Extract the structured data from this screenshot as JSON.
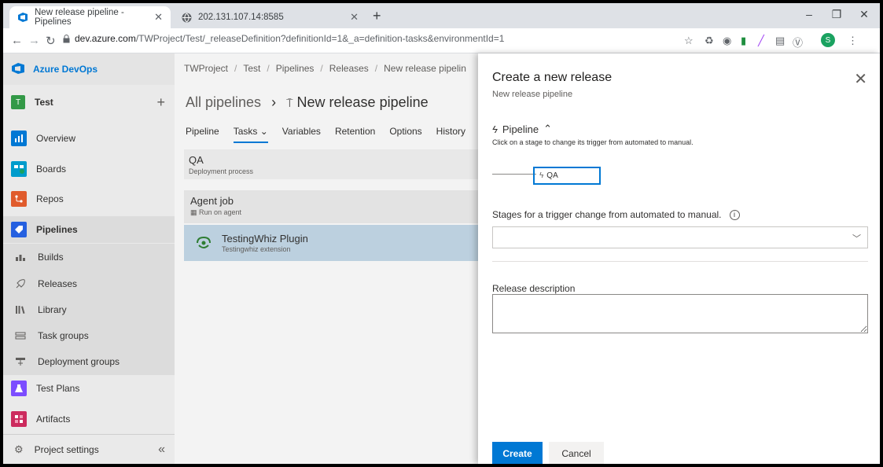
{
  "browser": {
    "tabs": [
      {
        "title": "New release pipeline - Pipelines",
        "active": true
      },
      {
        "title": "202.131.107.14:8585",
        "active": false
      }
    ],
    "url_host": "dev.azure.com",
    "url_path": "/TWProject/Test/_releaseDefinition?definitionId=1&_a=definition-tasks&environmentId=1",
    "profile_initial": "S"
  },
  "app": {
    "name": "Azure DevOps",
    "project_badge": "T",
    "project_name": "Test",
    "nav": [
      {
        "label": "Overview",
        "icon": "overview-icon"
      },
      {
        "label": "Boards",
        "icon": "boards-icon"
      },
      {
        "label": "Repos",
        "icon": "repos-icon"
      },
      {
        "label": "Pipelines",
        "icon": "pipelines-icon"
      },
      {
        "label": "Builds",
        "icon": "builds-icon"
      },
      {
        "label": "Releases",
        "icon": "releases-icon"
      },
      {
        "label": "Library",
        "icon": "library-icon"
      },
      {
        "label": "Task groups",
        "icon": "task-groups-icon"
      },
      {
        "label": "Deployment groups",
        "icon": "deployment-groups-icon"
      },
      {
        "label": "Test Plans",
        "icon": "test-plans-icon"
      },
      {
        "label": "Artifacts",
        "icon": "artifacts-icon"
      }
    ],
    "settings_label": "Project settings"
  },
  "main": {
    "breadcrumbs": [
      "TWProject",
      "Test",
      "Pipelines",
      "Releases",
      "New release pipelin"
    ],
    "title_prefix": "All pipelines",
    "title": "New release pipeline",
    "tabs": [
      "Pipeline",
      "Tasks",
      "Variables",
      "Retention",
      "Options",
      "History"
    ],
    "stage_name": "QA",
    "stage_sub": "Deployment process",
    "job_name": "Agent job",
    "job_sub": "Run on agent",
    "task_name": "TestingWhiz Plugin",
    "task_sub": "Testingwhiz extension"
  },
  "panel": {
    "title": "Create a new release",
    "subtitle": "New release pipeline",
    "pipeline_label": "Pipeline",
    "pipeline_hint": "Click on a stage to change its trigger from automated to manual.",
    "stage_chip": "QA",
    "trigger_label": "Stages for a trigger change from automated to manual.",
    "trigger_value": "",
    "description_label": "Release description",
    "description_value": "",
    "create_label": "Create",
    "cancel_label": "Cancel"
  },
  "colors": {
    "accent": "#0078d4",
    "project_badge": "#339947"
  }
}
